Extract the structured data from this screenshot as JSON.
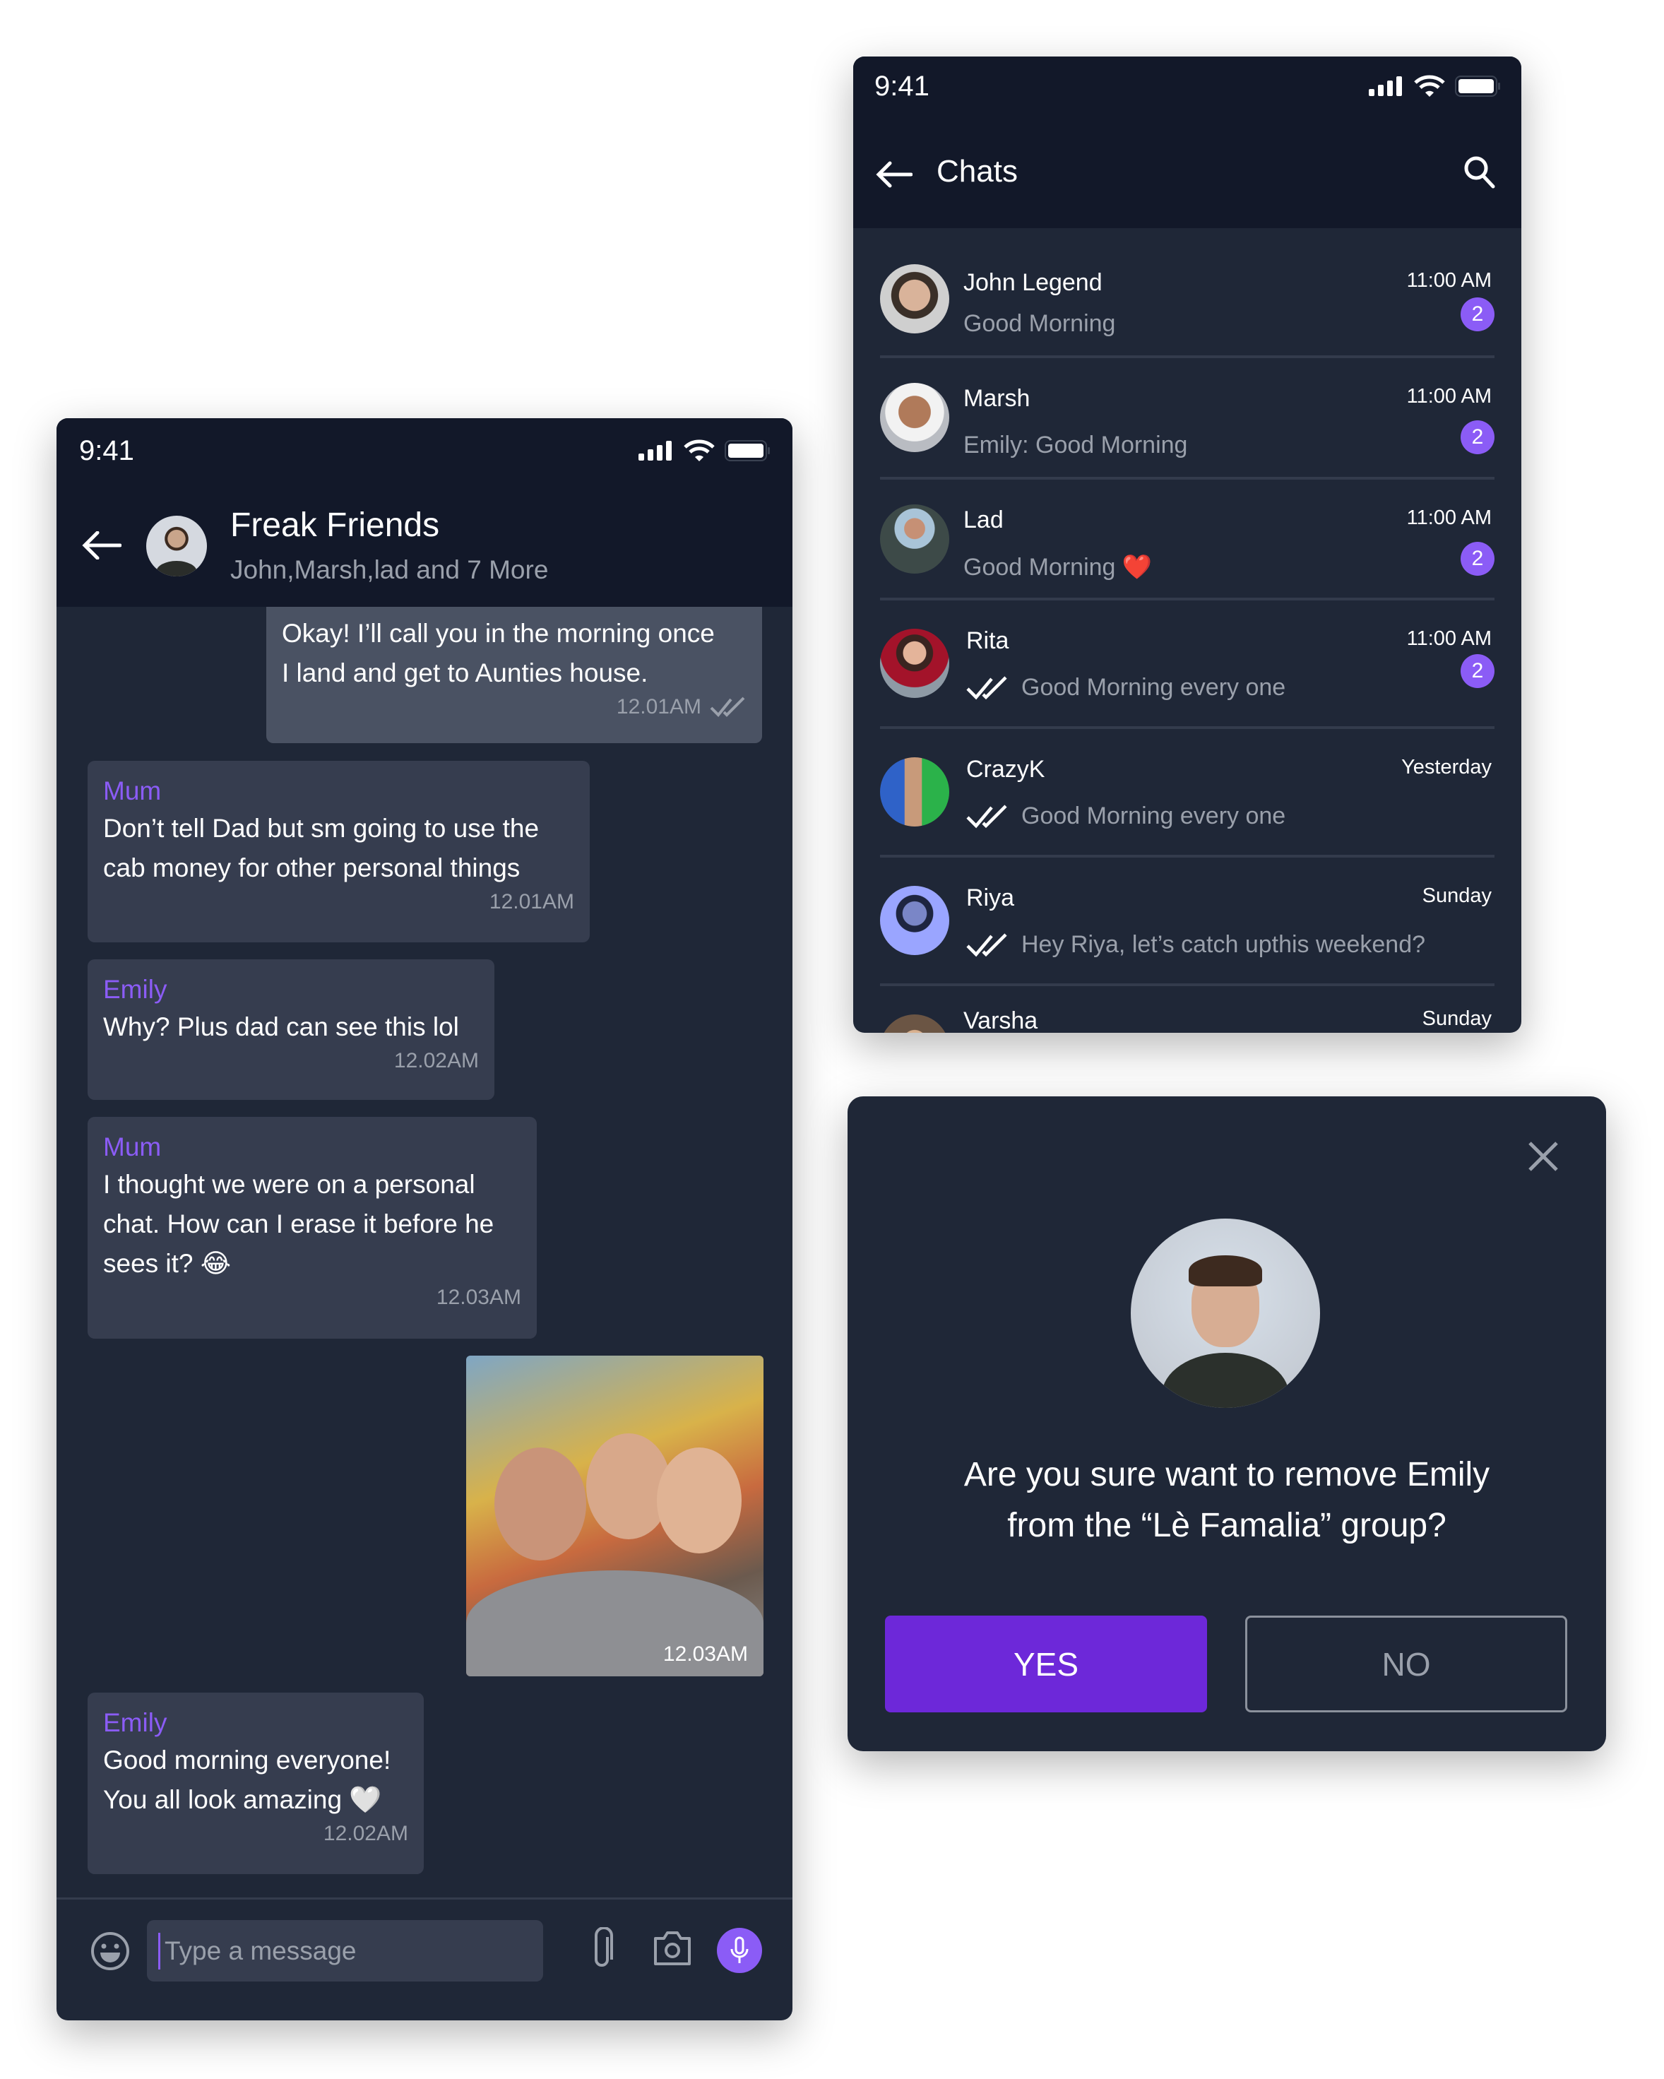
{
  "colors": {
    "accent": "#8b5cf6",
    "yes_button": "#6d28d9",
    "header": "#121829",
    "panel": "#1f2737"
  },
  "group_chat": {
    "status_time": "9:41",
    "title": "Freak Friends",
    "subtitle": "John,Marsh,lad and 7 More",
    "messages": [
      {
        "type": "outgoing",
        "text": [
          "Okay! I’ll call you in the morning once",
          "I land and get to Aunties house."
        ],
        "time": "12.01AM",
        "status": "read-double-check"
      },
      {
        "type": "incoming",
        "sender": "Mum",
        "text": [
          "Don’t tell Dad but sm going to use the",
          "cab money for other personal things"
        ],
        "time": "12.01AM"
      },
      {
        "type": "incoming",
        "sender": "Emily",
        "text": [
          "Why? Plus dad can see this lol"
        ],
        "time": "12.02AM"
      },
      {
        "type": "incoming",
        "sender": "Mum",
        "text": [
          "I thought we were on a personal",
          "chat. How can I erase it before he",
          "sees it? 😂"
        ],
        "time": "12.03AM"
      },
      {
        "type": "outgoing-image",
        "time": "12.03AM"
      },
      {
        "type": "incoming",
        "sender": "Emily",
        "text": [
          "Good morning everyone!",
          "You all look amazing 🤍"
        ],
        "time": "12.02AM"
      }
    ],
    "input_placeholder": "Type a message"
  },
  "chats_list": {
    "status_time": "9:41",
    "title": "Chats",
    "rows": [
      {
        "name": "John Legend",
        "preview": "Good Morning",
        "time": "11:00 AM",
        "unread": "2",
        "read_check": false
      },
      {
        "name": "Marsh",
        "preview": "Emily: Good Morning",
        "time": "11:00 AM",
        "unread": "2",
        "read_check": false
      },
      {
        "name": "Lad",
        "preview": "Good Morning ❤️",
        "time": "11:00 AM",
        "unread": "2",
        "read_check": false
      },
      {
        "name": "Rita",
        "preview": "Good Morning every one",
        "time": "11:00 AM",
        "unread": "2",
        "read_check": true
      },
      {
        "name": "CrazyK",
        "preview": "Good Morning every one",
        "time": "Yesterday",
        "read_check": true
      },
      {
        "name": "Riya",
        "preview": "Hey Riya, let’s catch upthis weekend?",
        "time": "Sunday",
        "read_check": true
      },
      {
        "name": "Varsha",
        "time": "Sunday"
      }
    ]
  },
  "dialog": {
    "message_line1": "Are you sure want to remove Emily",
    "message_line2": "from the “Lè Famalia” group?",
    "yes_label": "YES",
    "no_label": "NO"
  }
}
